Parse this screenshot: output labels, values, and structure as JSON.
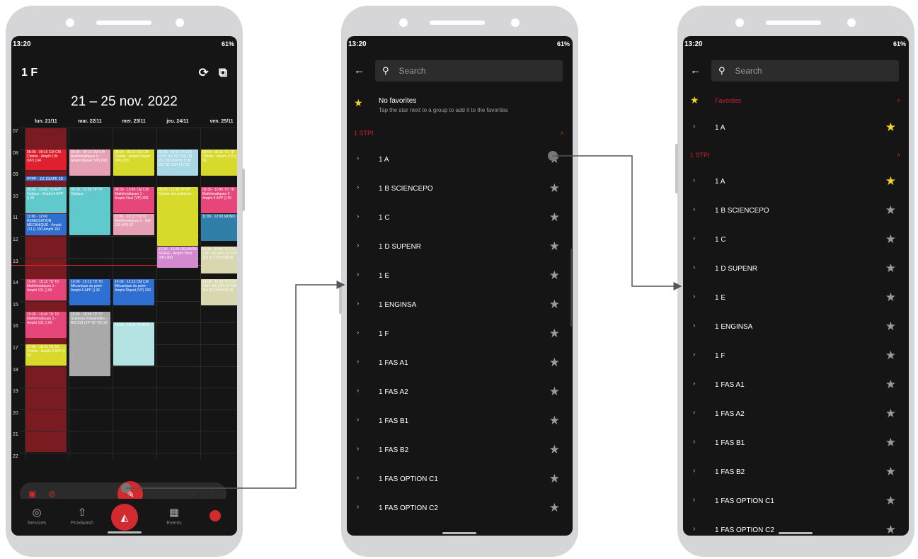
{
  "status_bar": {
    "time": "13:20",
    "right": "61%"
  },
  "calendar": {
    "group": "1 F",
    "week": "21 – 25 nov. 2022",
    "days": [
      "lun. 21/11",
      "mar. 22/11",
      "mer. 23/11",
      "jeu. 24/11",
      "ven. 25/11"
    ],
    "hours": [
      "07",
      "08",
      "09",
      "10",
      "11",
      "12",
      "13",
      "14",
      "15",
      "16",
      "17",
      "18",
      "19",
      "20",
      "21",
      "22"
    ],
    "events": [
      {
        "col": 0,
        "start": 8,
        "end": 9,
        "color": "#e0202e",
        "text": "08:00 - 09:15 CM CM Chimie - Amphi 104 (VP) 104"
      },
      {
        "col": 0,
        "start": 9.25,
        "end": 9.5,
        "color": "#2f6fd1",
        "text": "PPPP - 111 ESAPE 2D"
      },
      {
        "col": 0,
        "start": 9.75,
        "end": 11,
        "color": "#5fc9cc",
        "text": "09:45 - 10:45 TD APP Optique - Amphi 5 APP () 56"
      },
      {
        "col": 0,
        "start": 11,
        "end": 12,
        "color": "#2f6fd1",
        "text": "11:00 - 12:00 REMEDIATION MECANIQUE - Amphi 111 () 100 Amphi 103"
      },
      {
        "col": 0,
        "start": 14,
        "end": 15,
        "color": "#e6467a",
        "text": "14:00 - 15:15 TD TD Mathématiques 1 - Amphi 101 () 60"
      },
      {
        "col": 0,
        "start": 15.5,
        "end": 16.75,
        "color": "#e6467a",
        "text": "15:30 - 16:45 TD TD Mathématiques 1 - Amphi 101 () 60"
      },
      {
        "col": 0,
        "start": 17,
        "end": 18,
        "color": "#d7da2a",
        "text": "17:00 - 18:15 TD TD Chimie - Amphi 9 APP () 56"
      },
      {
        "col": 1,
        "start": 8,
        "end": 9.25,
        "color": "#e6a0b4",
        "text": "08:00 - 09:15 CM CM Mathématiques 0 - Amphi Riquet (VP) 200"
      },
      {
        "col": 1,
        "start": 9.75,
        "end": 12,
        "color": "#5fc9cc",
        "text": "09:30 - 12:30 TP TP Optique -"
      },
      {
        "col": 1,
        "start": 14,
        "end": 15.25,
        "color": "#2f6fd1",
        "text": "14:00 - 15:15 TD TD Mécanique du point - Amphi 6 APP () 36"
      },
      {
        "col": 1,
        "start": 15.5,
        "end": 18.5,
        "color": "#a9a9a9",
        "text": "15:30 - 18:30 TP TP Sciences Industrielles - BM 218 (VP-TB TR) 30"
      },
      {
        "col": 2,
        "start": 8,
        "end": 9.25,
        "color": "#d7da2a",
        "text": "08:00 - 09:15 CM CM Chimie - Amphi Riquet (VP) 200"
      },
      {
        "col": 2,
        "start": 9.75,
        "end": 11,
        "color": "#e6467a",
        "text": "09:30 - 10:45 CM CM Mathématiques 1 - Amphi Vinci (VP) 300"
      },
      {
        "col": 2,
        "start": 11,
        "end": 12,
        "color": "#e6a0b4",
        "text": "11:00 - 12:15 TD TD Mathématiques 0 - Gbl 118 (VP) 52"
      },
      {
        "col": 2,
        "start": 14,
        "end": 15.25,
        "color": "#2f6fd1",
        "text": "14:00 - 15:15 CM CM Mécanique du point - Amphi Riquet (VP) 200"
      },
      {
        "col": 2,
        "start": 16,
        "end": 18,
        "color": "#b4e3e3",
        "text": "16:00 - 18:00 TD APS -"
      },
      {
        "col": 3,
        "start": 8,
        "end": 9.25,
        "color": "#a8d8e6",
        "text": "08:00 - 09:15 TD LV2 - CSH 113 33 CSH 111 25 CSH 014 55 CSH 012 52 CSH 217 23"
      },
      {
        "col": 3,
        "start": 9.75,
        "end": 12.5,
        "color": "#d7da2a",
        "text": "09:30 - 12:30 TP TP Chimie des solutions -"
      },
      {
        "col": 3,
        "start": 12.5,
        "end": 13.5,
        "color": "#d58ad0",
        "text": "12:30 - 13:30 REUNION STAGE - Amphi Vinci (VP) 300"
      },
      {
        "col": 4,
        "start": 8,
        "end": 9.25,
        "color": "#d7da2a",
        "text": "08:00 - 09:15 TD TD Chimie - Amphi 103 () 56"
      },
      {
        "col": 4,
        "start": 9.75,
        "end": 11,
        "color": "#e6467a",
        "text": "09:30 - 10:45 TD TD Mathématiques 0 - Amphi 9 APP () 56"
      },
      {
        "col": 4,
        "start": 11,
        "end": 12.25,
        "color": "#2f7fa8",
        "text": "11:00 - 12:00 MONO"
      },
      {
        "col": 4,
        "start": 12.5,
        "end": 13.75,
        "color": "#d8d7b0",
        "text": "12:30 - 13:45 TD LV1 - CSH 102 (VP) 33 CSH 110 37 CSH 014 55"
      },
      {
        "col": 4,
        "start": 14,
        "end": 15.25,
        "color": "#d8d7b0",
        "text": "14:00 - 15:15 TD LV1 - CSH 102 (VP) 33 CSH 110 37 CSH 014 55"
      }
    ],
    "bottom_nav": [
      {
        "label": "Services",
        "icon": "services-icon"
      },
      {
        "label": "Proxiwash",
        "icon": "proxiwash-icon"
      },
      {
        "label": "",
        "icon": "planex-icon"
      },
      {
        "label": "Events",
        "icon": "events-icon"
      },
      {
        "label": "",
        "icon": "clock-icon"
      }
    ]
  },
  "picker1": {
    "search_placeholder": "Search",
    "nofav_title": "No favorites",
    "nofav_sub": "Tap the star next to a group to add it to the favorites",
    "section": "1 STPI",
    "groups": [
      "1 A",
      "1 B SCIENCEPO",
      "1 C",
      "1 D SUPENR",
      "1 E",
      "1 ENGINSA",
      "1 F",
      "1 FAS A1",
      "1 FAS A2",
      "1 FAS B1",
      "1 FAS B2",
      "1 FAS OPTION C1",
      "1 FAS OPTION C2"
    ]
  },
  "picker2": {
    "search_placeholder": "Search",
    "favorites_label": "Favorites",
    "favorites": [
      "1 A"
    ],
    "section": "1 STPI",
    "groups": [
      "1 A",
      "1 B SCIENCEPO",
      "1 C",
      "1 D SUPENR",
      "1 E",
      "1 ENGINSA",
      "1 F",
      "1 FAS A1",
      "1 FAS A2",
      "1 FAS B1",
      "1 FAS B2",
      "1 FAS OPTION C1",
      "1 FAS OPTION C2"
    ],
    "starred": [
      "1 A"
    ]
  },
  "colors": {
    "accent": "#d32a2f",
    "star_on": "#f3d22a",
    "star_off": "#9a9a9a",
    "section": "#c8232e"
  }
}
